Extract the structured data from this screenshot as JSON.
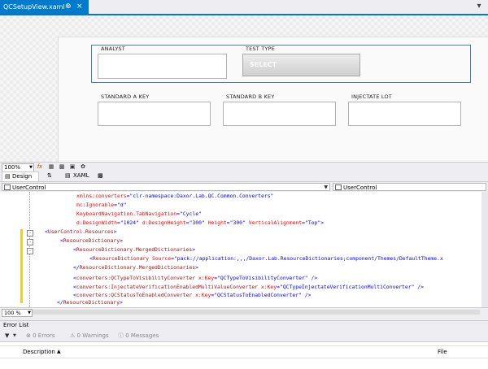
{
  "document_tab": {
    "title": "QCSetupView.xaml",
    "pin": "⊕",
    "close": "×"
  },
  "designer": {
    "analyst_label": "ANALYST",
    "test_type_label": "TEST TYPE",
    "select_button": "SELECT",
    "std_a_label": "STANDARD A KEY",
    "std_b_label": "STANDARD B KEY",
    "injectate_label": "INJECTATE LOT"
  },
  "designer_toolbar": {
    "zoom": "100%",
    "fx": "fx"
  },
  "split_tabs": {
    "design": "Design",
    "swap": "⇅",
    "xaml": "XAML"
  },
  "combos": {
    "left": "UserControl",
    "right": "UserControl"
  },
  "code": {
    "l1": {
      "a": "xmlns:converters",
      "v": "\"clr-namespace:Daxor.Lab.QC.Common.Converters\""
    },
    "l2": {
      "a": "mc:Ignorable",
      "v": "\"d\""
    },
    "l3": {
      "a": "KeyboardNavigation.TabNavigation",
      "v": "\"Cycle\""
    },
    "l4": {
      "a1": "d:DesignWidth",
      "v1": "\"1024\"",
      "a2": "d:DesignHeight",
      "v2": "\"300\"",
      "a3": "Height",
      "v3": "\"300\"",
      "a4": "VerticalAlignment",
      "v4": "\"Top\""
    },
    "l5": {
      "tag": "UserControl.Resources"
    },
    "l6": {
      "tag": "ResourceDictionary"
    },
    "l7": {
      "tag": "ResourceDictionary.MergedDictionaries"
    },
    "l8": {
      "tag": "ResourceDictionary",
      "a": "Source",
      "v": "\"pack://application:,,,/Daxor.Lab.ResourceDictionaries;component/Themes/DefaultTheme.x"
    },
    "l9": {
      "tag": "ResourceDictionary.MergedDictionaries"
    },
    "l10": {
      "tag": "converters:QCTypeToVisibilityConverter",
      "a": "x:Key",
      "v": "\"QCTypeToVisibilityConverter\""
    },
    "l11": {
      "tag": "converters:InjectateVerificationEnabledMultiValueConverter",
      "a": "x:Key",
      "v": "\"QCTypeInjectateVerificationMultiConverter\""
    },
    "l12": {
      "tag": "converters:QCStatusToEnabledConverter",
      "a": "x:Key",
      "v": "\"QCStatusToEnabledConverter\""
    },
    "l13": {
      "tag": "ResourceDictionary"
    }
  },
  "editor_zoom": "100 %",
  "error_list": {
    "title": "Error List",
    "errors": "0 Errors",
    "warnings": "0 Warnings",
    "messages": "0 Messages",
    "col_description": "Description",
    "col_file": "File"
  }
}
